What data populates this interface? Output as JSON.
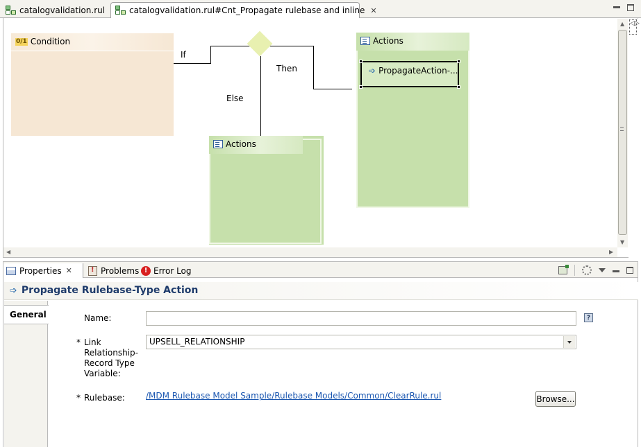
{
  "editor_tabs": [
    {
      "label": "catalogvalidation.rul",
      "active": false
    },
    {
      "label": "catalogvalidation.rul#Cnt_Propagate rulebase and inline",
      "active": true,
      "close": "✕"
    }
  ],
  "palette": {
    "glyph": "◁▷"
  },
  "diagram": {
    "condition_label": "Condition",
    "condition_icon": "0/1",
    "if_label": "If",
    "then_label": "Then",
    "else_label": "Else",
    "then_actions_label": "Actions",
    "else_actions_label": "Actions",
    "action_node_label": "PropagateAction-..."
  },
  "views": {
    "tabs": [
      {
        "label": "Properties",
        "close": "✕"
      },
      {
        "label": "Problems"
      },
      {
        "label": "Error Log"
      }
    ]
  },
  "properties": {
    "title": "Propagate Rulebase-Type Action",
    "section": "General",
    "name_label": "Name:",
    "name_value": "",
    "link_label_lines": [
      "Link",
      "Relationship-",
      "Record Type",
      "Variable:"
    ],
    "link_value": "UPSELL_RELATIONSHIP",
    "rulebase_label": "Rulebase:",
    "rulebase_link": "/MDM Rulebase Model Sample/Rulebase Models/Common/ClearRule.rul",
    "browse_label": "Browse...",
    "required_marker": "*",
    "help_glyph": "?"
  },
  "icons": {
    "rule_file": "rule-file-icon",
    "action_arrow": "➩",
    "error": "!"
  },
  "colors": {
    "condition_fill": "#f6e7d4",
    "actions_fill": "#c6e0ab",
    "diamond_fill": "#e8f0b0",
    "title_text": "#1e3b6b",
    "link_text": "#1a56b0"
  }
}
